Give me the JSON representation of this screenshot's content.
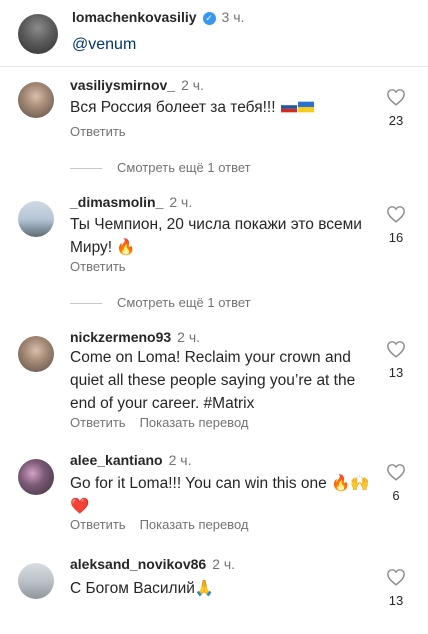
{
  "post": {
    "username": "lomachenkovasiliy",
    "time": "3 ч.",
    "mention": "@venum"
  },
  "labels": {
    "reply": "Ответить",
    "translate": "Показать перевод",
    "more_replies": "Смотреть ещё 1 ответ"
  },
  "comments": [
    {
      "username": "vasiliysmirnov_",
      "time": "2 ч.",
      "text": "Вся Россия болеет за тебя!!!",
      "likes": "23"
    },
    {
      "username": "_dimasmolin_",
      "time": "2 ч.",
      "text": "Ты Чемпион, 20 числа покажи это всеми Миру! 🔥",
      "likes": "16"
    },
    {
      "username": "nickzermeno93",
      "time": "2 ч.",
      "text": "Come on Loma! Reclaim your crown and quiet all these people saying you’re at the end of your career. #Matrix",
      "likes": "13"
    },
    {
      "username": "alee_kantiano",
      "time": "2 ч.",
      "text": "Go for it Loma!!! You can win this one 🔥🙌 ❤️",
      "likes": "6"
    },
    {
      "username": "aleksand_novikov86",
      "time": "2 ч.",
      "text": "С Богом Василий🙏",
      "likes": "13"
    }
  ],
  "colors": {
    "text": "#262626",
    "secondary": "#737373",
    "link": "#00376b",
    "verified": "#3897f0"
  }
}
